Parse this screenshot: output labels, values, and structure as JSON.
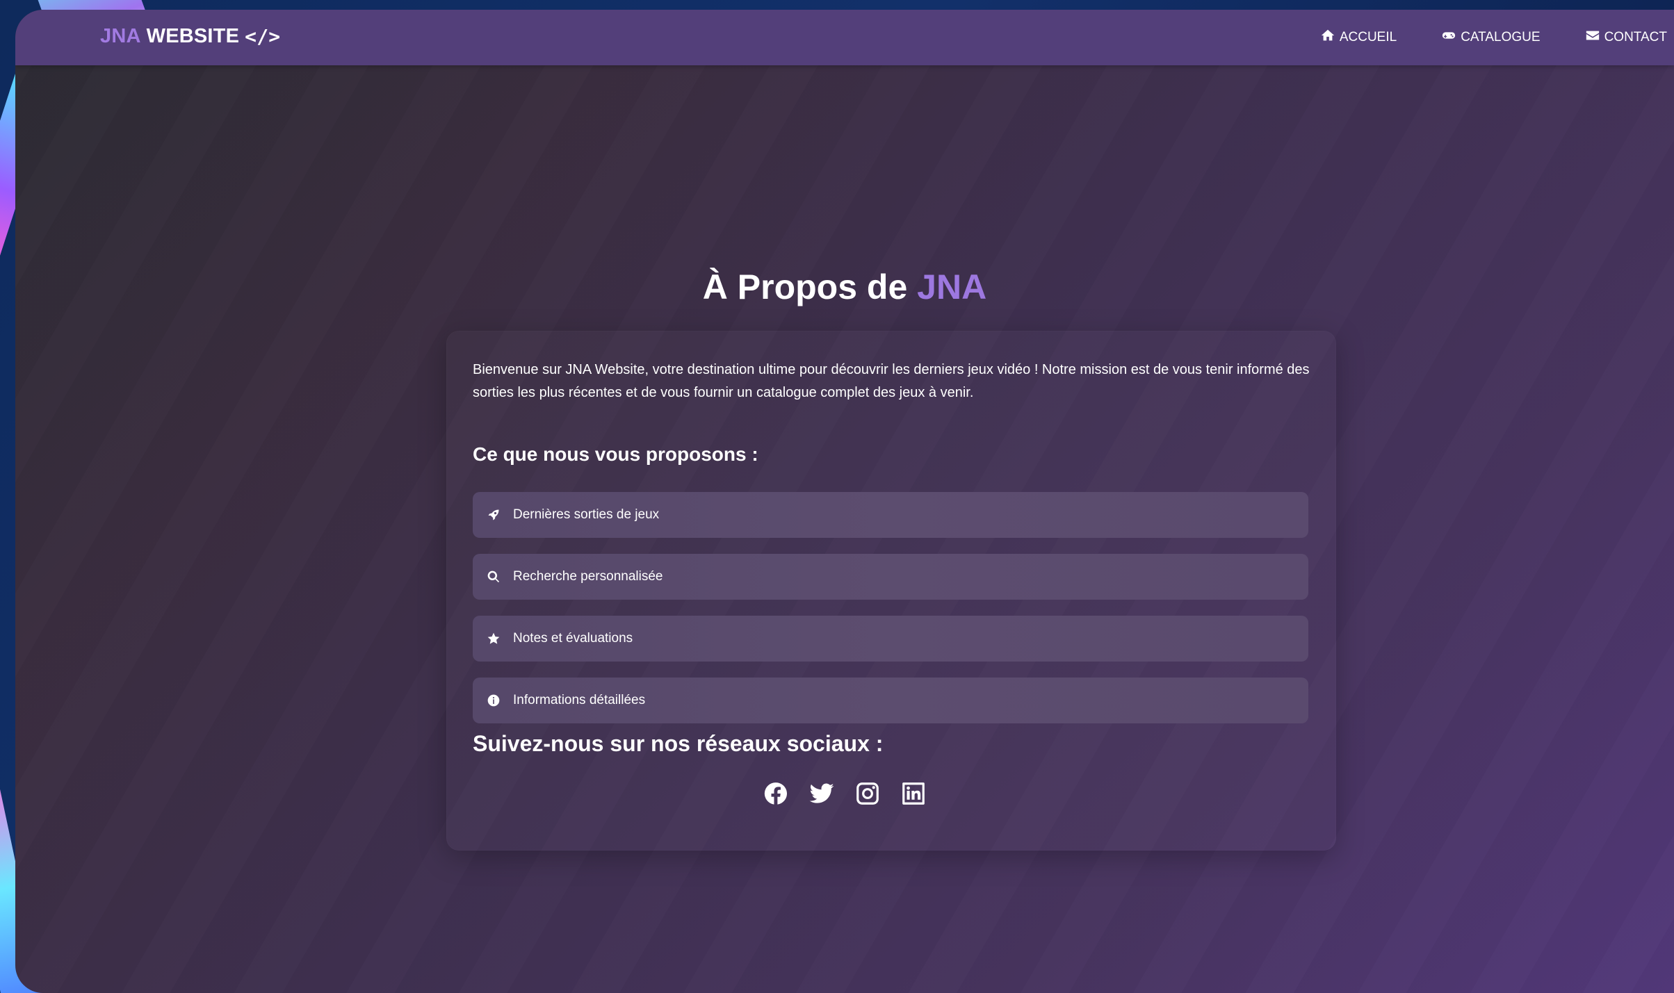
{
  "navbar": {
    "brand_accent": "JNA",
    "brand_main": "WEBSITE",
    "brand_icon": "</>",
    "links": [
      {
        "label": "ACCUEIL",
        "icon": "home-icon"
      },
      {
        "label": "CATALOGUE",
        "icon": "gamepad-icon"
      },
      {
        "label": "CONTACT",
        "icon": "envelope-icon"
      }
    ]
  },
  "main": {
    "title_prefix": "À Propos de",
    "title_accent": "JNA",
    "intro": "Bienvenue sur JNA Website, votre destination ultime pour découvrir les derniers jeux vidéo ! Notre mission est de vous tenir informé des sorties les plus récentes et de vous fournir un catalogue complet des jeux à venir.",
    "offer_heading": "Ce que nous vous proposons :",
    "features": [
      {
        "label": "Dernières sorties de jeux",
        "icon": "rocket-icon"
      },
      {
        "label": "Recherche personnalisée",
        "icon": "search-icon"
      },
      {
        "label": "Notes et évaluations",
        "icon": "star-icon"
      },
      {
        "label": "Informations détaillées",
        "icon": "info-icon"
      }
    ],
    "social_heading": "Suivez-nous sur nos réseaux sociaux :",
    "socials": [
      "facebook-icon",
      "twitter-icon",
      "instagram-icon",
      "linkedin-icon"
    ]
  },
  "colors": {
    "navbar_bg": "#533f7a",
    "accent": "#9d78e0",
    "feature_bg": "#5a4a6e",
    "text": "#ffffff"
  }
}
